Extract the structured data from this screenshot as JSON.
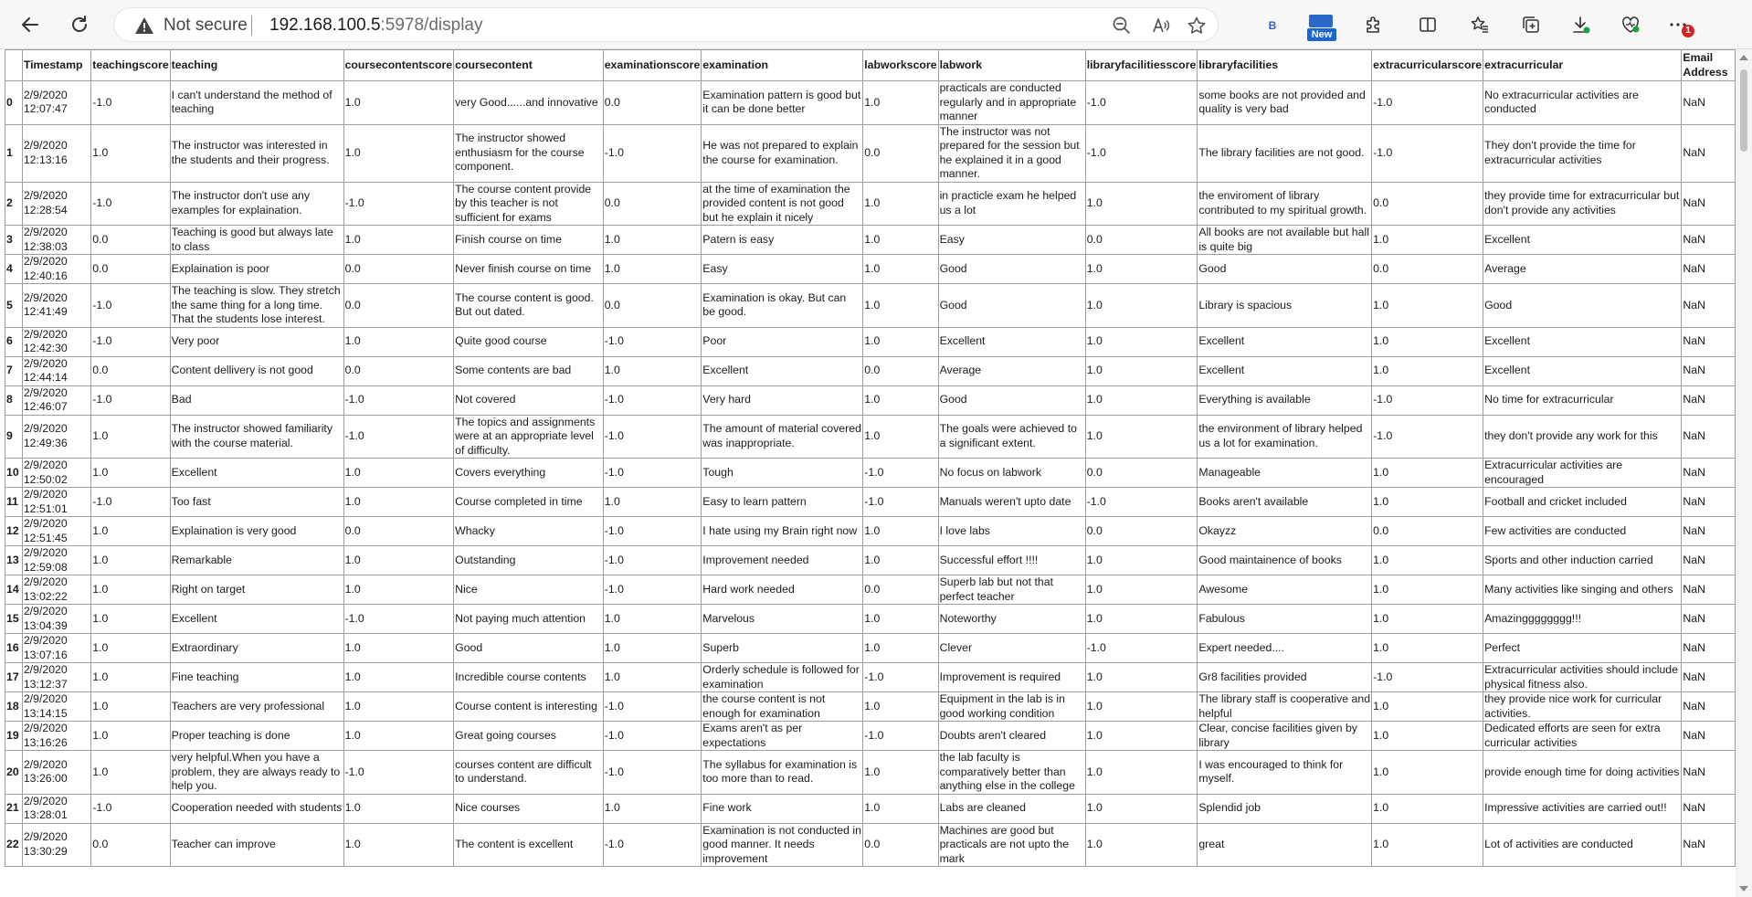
{
  "browser": {
    "security_label": "Not secure",
    "url_host": "192.168.100.5",
    "url_rest": ":5978/display",
    "extension_b_label": "B",
    "new_badge_label": "New",
    "notification_count": "1",
    "icons": [
      "back-icon",
      "refresh-icon",
      "warning-icon",
      "zoom-out-icon",
      "read-aloud-icon",
      "favorite-star-icon",
      "extensions-icon",
      "split-screen-icon",
      "favorites-icon",
      "collections-icon",
      "downloads-icon",
      "browser-essentials-icon",
      "more-icon"
    ]
  },
  "table": {
    "columns": [
      "",
      "Timestamp",
      "teachingscore",
      "teaching",
      "coursecontentscore",
      "coursecontent",
      "examinationscore",
      "examination",
      "labworkscore",
      "labwork",
      "libraryfacilitiesscore",
      "libraryfacilities",
      "extracurricularscore",
      "extracurricular",
      "Email Address"
    ],
    "rows": [
      [
        "0",
        "2/9/2020 12:07:47",
        "-1.0",
        "I can't understand the method of teaching",
        "1.0",
        "very Good......and innovative",
        "0.0",
        "Examination pattern is good but it can be done better",
        "1.0",
        "practicals are conducted regularly and in appropriate manner",
        "-1.0",
        "some books are not provided and quality is very bad",
        "-1.0",
        "No extracurricular activities are conducted",
        "NaN"
      ],
      [
        "1",
        "2/9/2020 12:13:16",
        "1.0",
        "The instructor was interested in the students and their progress.",
        "1.0",
        "The instructor showed enthusiasm for the course component.",
        "-1.0",
        "He was not prepared to explain the course for examination.",
        "0.0",
        "The instructor was not prepared for the session but he explained it in a good manner.",
        "-1.0",
        "The library facilities are not good.",
        "-1.0",
        "They don't provide the time for extracurricular activities",
        "NaN"
      ],
      [
        "2",
        "2/9/2020 12:28:54",
        "-1.0",
        "The instructor don't use any examples for explaination.",
        "-1.0",
        "The course content provide by this teacher is not sufficient for exams",
        "0.0",
        "at the time of examination the provided content is not good but he explain it nicely",
        "1.0",
        "in practicle exam he helped us a lot",
        "1.0",
        "the enviroment of library contributed to my spiritual growth.",
        "0.0",
        "they provide time for extracurricular but don't provide any activities",
        "NaN"
      ],
      [
        "3",
        "2/9/2020 12:38:03",
        "0.0",
        "Teaching is good but always late to class",
        "1.0",
        "Finish course on time",
        "1.0",
        "Patern is easy",
        "1.0",
        "Easy",
        "0.0",
        "All books are not available but hall is quite big",
        "1.0",
        "Excellent",
        "NaN"
      ],
      [
        "4",
        "2/9/2020 12:40:16",
        "0.0",
        "Explaination is poor",
        "0.0",
        "Never finish course on time",
        "1.0",
        "Easy",
        "1.0",
        "Good",
        "1.0",
        "Good",
        "0.0",
        "Average",
        "NaN"
      ],
      [
        "5",
        "2/9/2020 12:41:49",
        "-1.0",
        "The teaching is slow. They stretch the same thing for a long time. That the students lose interest.",
        "0.0",
        "The course content is good. But out dated.",
        "0.0",
        "Examination is okay. But can be good.",
        "1.0",
        "Good",
        "1.0",
        "Library is spacious",
        "1.0",
        "Good",
        "NaN"
      ],
      [
        "6",
        "2/9/2020 12:42:30",
        "-1.0",
        "Very poor",
        "1.0",
        "Quite good course",
        "-1.0",
        "Poor",
        "1.0",
        "Excellent",
        "1.0",
        "Excellent",
        "1.0",
        "Excellent",
        "NaN"
      ],
      [
        "7",
        "2/9/2020 12:44:14",
        "0.0",
        "Content dellivery is not good",
        "0.0",
        "Some contents are bad",
        "1.0",
        "Excellent",
        "0.0",
        "Average",
        "1.0",
        "Excellent",
        "1.0",
        "Excellent",
        "NaN"
      ],
      [
        "8",
        "2/9/2020 12:46:07",
        "-1.0",
        "Bad",
        "-1.0",
        "Not covered",
        "-1.0",
        "Very hard",
        "1.0",
        "Good",
        "1.0",
        "Everything is available",
        "-1.0",
        "No time for extracurricular",
        "NaN"
      ],
      [
        "9",
        "2/9/2020 12:49:36",
        "1.0",
        "The instructor showed familiarity with the course material.",
        "-1.0",
        "The topics and assignments were at an appropriate level of difficulty.",
        "-1.0",
        "The amount of material covered was inappropriate.",
        "1.0",
        "The goals were achieved to a significant extent.",
        "1.0",
        "the environment of library helped us a lot for examination.",
        "-1.0",
        "they don't provide any work for this",
        "NaN"
      ],
      [
        "10",
        "2/9/2020 12:50:02",
        "1.0",
        "Excellent",
        "1.0",
        "Covers everything",
        "-1.0",
        "Tough",
        "-1.0",
        "No focus on labwork",
        "0.0",
        "Manageable",
        "1.0",
        "Extracurricular activities are encouraged",
        "NaN"
      ],
      [
        "11",
        "2/9/2020 12:51:01",
        "-1.0",
        "Too fast",
        "1.0",
        "Course completed in time",
        "1.0",
        "Easy to learn pattern",
        "-1.0",
        "Manuals weren't upto date",
        "-1.0",
        "Books aren't available",
        "1.0",
        "Football and cricket included",
        "NaN"
      ],
      [
        "12",
        "2/9/2020 12:51:45",
        "1.0",
        "Explaination is very good",
        "0.0",
        "Whacky",
        "-1.0",
        "I hate using my Brain right now",
        "1.0",
        "I love labs",
        "0.0",
        "Okayzz",
        "0.0",
        "Few activities are conducted",
        "NaN"
      ],
      [
        "13",
        "2/9/2020 12:59:08",
        "1.0",
        "Remarkable",
        "1.0",
        "Outstanding",
        "-1.0",
        "Improvement needed",
        "1.0",
        "Successful effort !!!!",
        "1.0",
        "Good maintainence of books",
        "1.0",
        "Sports and other induction carried",
        "NaN"
      ],
      [
        "14",
        "2/9/2020 13:02:22",
        "1.0",
        "Right on target",
        "1.0",
        "Nice",
        "-1.0",
        "Hard work needed",
        "0.0",
        "Superb lab but not that perfect teacher",
        "1.0",
        "Awesome",
        "1.0",
        "Many activities like singing and others",
        "NaN"
      ],
      [
        "15",
        "2/9/2020 13:04:39",
        "1.0",
        "Excellent",
        "-1.0",
        "Not paying much attention",
        "1.0",
        "Marvelous",
        "1.0",
        "Noteworthy",
        "1.0",
        "Fabulous",
        "1.0",
        "Amazingggggggg!!!",
        "NaN"
      ],
      [
        "16",
        "2/9/2020 13:07:16",
        "1.0",
        "Extraordinary",
        "1.0",
        "Good",
        "1.0",
        "Superb",
        "1.0",
        "Clever",
        "-1.0",
        "Expert needed....",
        "1.0",
        "Perfect",
        "NaN"
      ],
      [
        "17",
        "2/9/2020 13:12:37",
        "1.0",
        "Fine teaching",
        "1.0",
        "Incredible course contents",
        "1.0",
        "Orderly schedule is followed for examination",
        "-1.0",
        "Improvement is required",
        "1.0",
        "Gr8 facilities provided",
        "-1.0",
        "Extracurricular activities should include physical fitness also.",
        "NaN"
      ],
      [
        "18",
        "2/9/2020 13:14:15",
        "1.0",
        "Teachers are very professional",
        "1.0",
        "Course content is interesting",
        "-1.0",
        "the course content is not enough for examination",
        "1.0",
        "Equipment in the lab is in good working condition",
        "1.0",
        "The library staff is cooperative and helpful",
        "1.0",
        "they provide nice work for curricular activities.",
        "NaN"
      ],
      [
        "19",
        "2/9/2020 13:16:26",
        "1.0",
        "Proper teaching is done",
        "1.0",
        "Great going courses",
        "-1.0",
        "Exams aren't as per expectations",
        "-1.0",
        "Doubts aren't cleared",
        "1.0",
        "Clear, concise facilities given by library",
        "1.0",
        "Dedicated efforts are seen for extra curricular activities",
        "NaN"
      ],
      [
        "20",
        "2/9/2020 13:26:00",
        "1.0",
        "very helpful.When you have a problem, they are always ready to help you.",
        "-1.0",
        "courses content are difficult to understand.",
        "-1.0",
        "The syllabus for examination is too more than to read.",
        "1.0",
        "the lab faculty is comparatively better than anything else in the college",
        "1.0",
        "I was encouraged to think for myself.",
        "1.0",
        "provide enough time for doing activities",
        "NaN"
      ],
      [
        "21",
        "2/9/2020 13:28:01",
        "-1.0",
        "Cooperation needed with students",
        "1.0",
        "Nice courses",
        "1.0",
        "Fine work",
        "1.0",
        "Labs are cleaned",
        "1.0",
        "Splendid job",
        "1.0",
        "Impressive activities are carried out!!",
        "NaN"
      ],
      [
        "22",
        "2/9/2020 13:30:29",
        "0.0",
        "Teacher can improve",
        "1.0",
        "The content is excellent",
        "-1.0",
        "Examination is not conducted in good manner. It needs improvement",
        "0.0",
        "Machines are good but practicals are not upto the mark",
        "1.0",
        "great",
        "1.0",
        "Lot of activities are conducted",
        "NaN"
      ]
    ]
  }
}
